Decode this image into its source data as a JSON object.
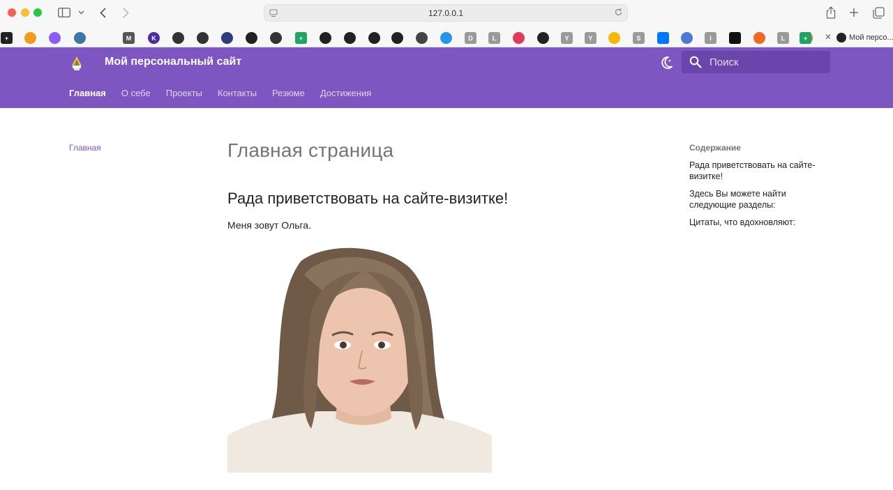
{
  "browser": {
    "url": "127.0.0.1",
    "tab_title": "Мой персо...",
    "bookmarks": [
      {
        "icon": "plus-icon",
        "color": "#222222",
        "glyph": "+"
      },
      {
        "icon": "mail-icon",
        "color": "#f29b1d",
        "glyph": ""
      },
      {
        "icon": "alice-icon",
        "color": "#8b5cf6",
        "glyph": ""
      },
      {
        "icon": "python-icon",
        "color": "#3b77a8",
        "glyph": ""
      },
      {
        "icon": "markdown-icon",
        "color": "#555555",
        "glyph": "M"
      },
      {
        "icon": "k-icon",
        "color": "#4b2aa7",
        "glyph": "K"
      },
      {
        "icon": "circle-icon",
        "color": "#333333",
        "glyph": ""
      },
      {
        "icon": "circle-icon",
        "color": "#333333",
        "glyph": ""
      },
      {
        "icon": "circle-icon",
        "color": "#2f3c7e",
        "glyph": ""
      },
      {
        "icon": "github-icon",
        "color": "#222222",
        "glyph": ""
      },
      {
        "icon": "circle-icon",
        "color": "#333333",
        "glyph": ""
      },
      {
        "icon": "plus-green-icon",
        "color": "#1fa463",
        "glyph": "+"
      },
      {
        "icon": "github-icon",
        "color": "#222222",
        "glyph": ""
      },
      {
        "icon": "github-icon",
        "color": "#222222",
        "glyph": ""
      },
      {
        "icon": "github-icon",
        "color": "#222222",
        "glyph": ""
      },
      {
        "icon": "github-icon",
        "color": "#222222",
        "glyph": ""
      },
      {
        "icon": "circle-icon",
        "color": "#444444",
        "glyph": ""
      },
      {
        "icon": "docker-icon",
        "color": "#2496ed",
        "glyph": ""
      },
      {
        "icon": "letter-d-icon",
        "color": "#9a9a9a",
        "glyph": "D"
      },
      {
        "icon": "letter-l-icon",
        "color": "#9a9a9a",
        "glyph": "L"
      },
      {
        "icon": "bowtie-icon",
        "color": "#e03c5a",
        "glyph": ""
      },
      {
        "icon": "github-icon",
        "color": "#222222",
        "glyph": ""
      },
      {
        "icon": "letter-y-icon",
        "color": "#9a9a9a",
        "glyph": "Y"
      },
      {
        "icon": "letter-y-icon",
        "color": "#9a9a9a",
        "glyph": "Y"
      },
      {
        "icon": "image-icon",
        "color": "#f5b800",
        "glyph": ""
      },
      {
        "icon": "letter-s-icon",
        "color": "#9a9a9a",
        "glyph": "S"
      },
      {
        "icon": "vk-icon",
        "color": "#0077ff",
        "glyph": ""
      },
      {
        "icon": "cube-icon",
        "color": "#4a7bd0",
        "glyph": ""
      },
      {
        "icon": "letter-i-icon",
        "color": "#9a9a9a",
        "glyph": "I"
      },
      {
        "icon": "ij-icon",
        "color": "#111111",
        "glyph": ""
      },
      {
        "icon": "gear-orange-icon",
        "color": "#f26a21",
        "glyph": ""
      },
      {
        "icon": "letter-l-icon",
        "color": "#9a9a9a",
        "glyph": "L"
      },
      {
        "icon": "gear-orange-icon",
        "color": "#f26a21",
        "glyph": ""
      },
      {
        "icon": "plus-green-icon",
        "color": "#1fa463",
        "glyph": "+"
      }
    ]
  },
  "site": {
    "title": "Мой персональный сайт",
    "accent_color": "#7e56c2",
    "search_placeholder": "Поиск",
    "nav": [
      "Главная",
      "О себе",
      "Проекты",
      "Контакты",
      "Резюме",
      "Достижения"
    ],
    "active_nav": "Главная"
  },
  "sidebar": {
    "items": [
      "Главная"
    ]
  },
  "content": {
    "page_title": "Главная страница",
    "section_title": "Рада приветствовать на сайте-визитке!",
    "intro": "Меня зовут Ольга."
  },
  "toc": {
    "title": "Содержание",
    "items": [
      "Рада приветствовать на сайте-визитке!",
      "Здесь Вы можете найти следующие разделы:",
      "Цитаты, что вдохновляют:"
    ]
  }
}
